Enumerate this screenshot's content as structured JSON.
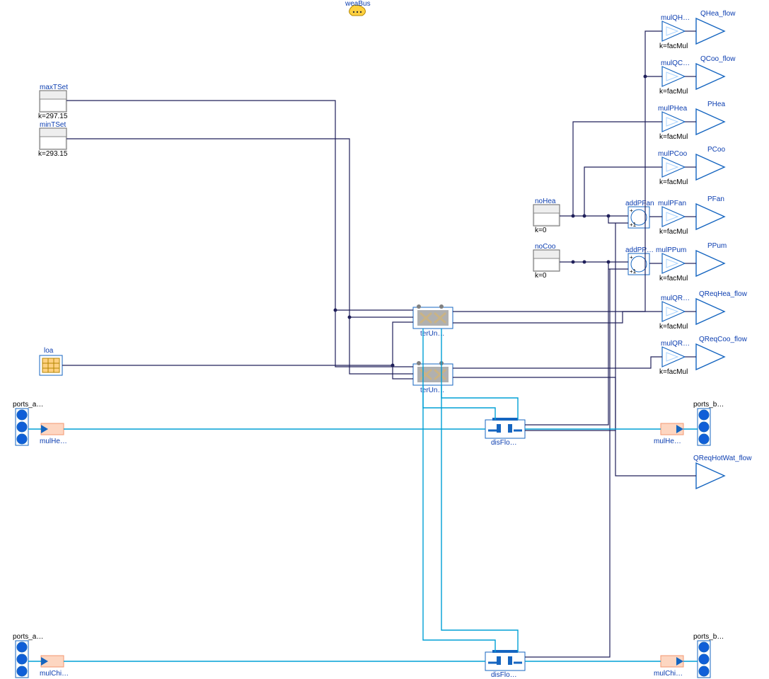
{
  "topBus": {
    "label": "weaBus"
  },
  "leftBlocks": {
    "maxTSet": {
      "label": "maxTSet",
      "k": "k=297.15"
    },
    "minTSet": {
      "label": "minTSet",
      "k": "k=293.15"
    },
    "loa": {
      "label": "loa"
    }
  },
  "midConsts": {
    "noHea": {
      "label": "noHea",
      "k": "k=0"
    },
    "noCoo": {
      "label": "noCoo",
      "k": "k=0"
    }
  },
  "terUnits": {
    "terUnHea": {
      "label": "terUn…"
    },
    "terUnCoo": {
      "label": "terUn…"
    }
  },
  "disFlo": {
    "hea": {
      "label": "disFlo…"
    },
    "coo": {
      "label": "disFlo…"
    }
  },
  "adders": {
    "addPFan": {
      "label": "addPFan"
    },
    "addPP": {
      "label": "addPP…"
    }
  },
  "ports": {
    "a1": "ports_a…",
    "b1": "ports_b…",
    "a2": "ports_a…",
    "b2": "ports_b…"
  },
  "mul": {
    "heaIn": "mulHe…",
    "heaOut": "mulHe…",
    "chiIn": "mulChi…",
    "chiOut": "mulChi…"
  },
  "gains": {
    "g1": {
      "label": "mulQH…",
      "k": "k=facMul",
      "out": "QHea_flow"
    },
    "g2": {
      "label": "mulQC…",
      "k": "k=facMul",
      "out": "QCoo_flow"
    },
    "g3": {
      "label": "mulPHea",
      "k": "k=facMul",
      "out": "PHea"
    },
    "g4": {
      "label": "mulPCoo",
      "k": "k=facMul",
      "out": "PCoo"
    },
    "g5": {
      "label": "mulPFan",
      "k": "k=facMul",
      "out": "PFan"
    },
    "g6": {
      "label": "mulPPum",
      "k": "k=facMul",
      "out": "PPum"
    },
    "g7": {
      "label": "mulQR…",
      "k": "k=facMul",
      "out": "QReqHea_flow"
    },
    "g8": {
      "label": "mulQR…",
      "k": "k=facMul",
      "out": "QReqCoo_flow"
    }
  },
  "outSingle": {
    "label": "QReqHotWat_flow"
  }
}
